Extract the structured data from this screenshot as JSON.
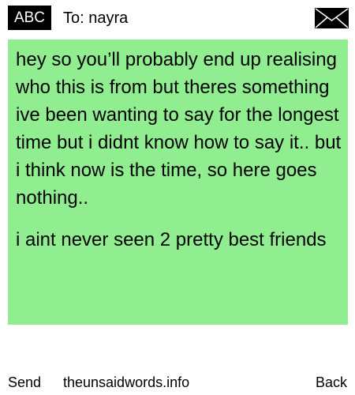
{
  "header": {
    "logo": "ABC",
    "to_label": "To: nayra",
    "mail_icon": "envelope-icon"
  },
  "message": {
    "background_color": "#90ee90",
    "body": "hey so you’ll probably end up realising who this is from but theres something ive been wanting to say for the longest time but i didnt know how to say it.. but i think now is the time, so here goes nothing..",
    "overlay": "i aint never seen 2 pretty best friends"
  },
  "footer": {
    "send_label": "Send",
    "site_label": "theunsaidwords.info",
    "back_label": "Back"
  }
}
